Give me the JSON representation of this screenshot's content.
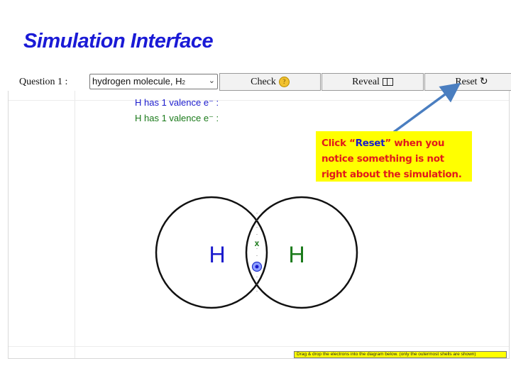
{
  "page": {
    "title": "Simulation Interface"
  },
  "toolbar": {
    "question_label": "Question 1 :",
    "select_value": "hydrogen molecule, H",
    "select_subscript": "2",
    "check_label": "Check",
    "reveal_label": "Reveal",
    "reset_label": "Reset ↻"
  },
  "valence": {
    "line1": "H has 1 valence e⁻ :",
    "line2": "H has 1 valence e⁻ :"
  },
  "callout": {
    "text_pre": "Click “",
    "keyword": "Reset",
    "text_post": "” when you notice something is not right about the simulation."
  },
  "diagram": {
    "atom_left_label": "H",
    "atom_right_label": "H",
    "marker_label": "x"
  },
  "hint": {
    "text": "Drag & drop the electrons into the diagram below. (only the outermost shells are shown)"
  },
  "colors": {
    "title": "#1a1ad6",
    "atom_left": "#1a1acc",
    "atom_right": "#1a7a1a",
    "callout_bg": "#ffff00",
    "callout_text": "#e11b1b",
    "arrow": "#4a7ec0"
  }
}
